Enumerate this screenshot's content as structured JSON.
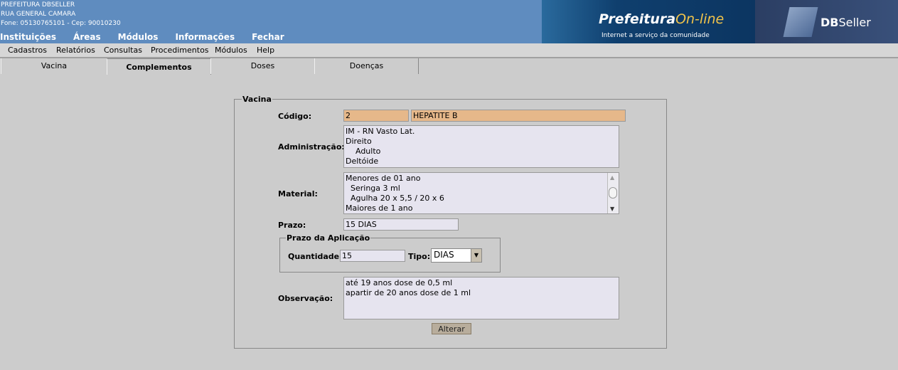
{
  "header": {
    "org_name": "PREFEITURA DBSELLER",
    "address": "RUA GENERAL CAMARA",
    "contact": "Fone: 05130765101  -  Cep: 90010230",
    "nav": [
      "Instituições",
      "Áreas",
      "Módulos",
      "Informações",
      "Fechar"
    ],
    "banner_logo_main": "Prefeitura",
    "banner_logo_accent": "On-line",
    "banner_tagline": "Internet a serviço da comunidade",
    "brand_bold": "DB",
    "brand_rest": "Seller"
  },
  "menu": [
    "Cadastros",
    "Relatórios",
    "Consultas",
    "Procedimentos",
    "Módulos",
    "Help"
  ],
  "tabs": [
    "Vacina",
    "Complementos",
    "Doses",
    "Doenças"
  ],
  "active_tab": "Complementos",
  "form": {
    "legend": "Vacina",
    "codigo_label": "Código:",
    "codigo_value": "2",
    "nome_value": "HEPATITE B",
    "administracao_label": "Administração:",
    "administracao_lines": [
      "IM - RN Vasto Lat.",
      "Direito",
      "    Adulto",
      "Deltóide"
    ],
    "material_label": "Material:",
    "material_lines": [
      "Menores de 01 ano",
      "  Seringa 3 ml",
      "  Agulha 20 x 5,5 / 20 x 6",
      "Maiores de 1 ano"
    ],
    "prazo_label": "Prazo:",
    "prazo_value": "15 DIAS",
    "aplicacao_legend": "Prazo da Aplicação",
    "quantidade_label": "Quantidade:",
    "quantidade_value": "15",
    "tipo_label": "Tipo:",
    "tipo_value": "DIAS",
    "observacao_label": "Observação:",
    "observacao_lines": [
      "até 19 anos dose de 0,5 ml",
      "apartir de 20 anos dose de 1 ml"
    ],
    "alterar_button": "Alterar"
  },
  "colors": {
    "header_bg": "#5f8cbf",
    "readonly_field": "#e6b88a",
    "field_bg": "#e6e4ef",
    "page_bg": "#cccccc"
  }
}
